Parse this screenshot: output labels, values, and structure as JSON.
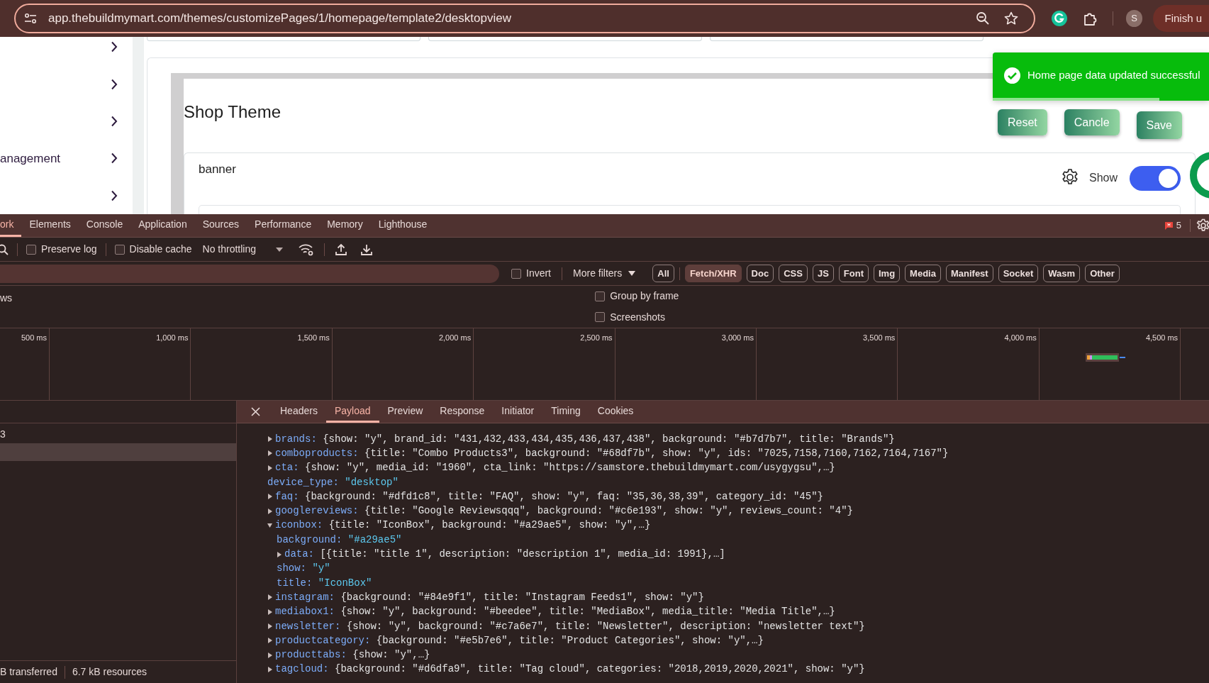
{
  "browser": {
    "url": "app.thebuildmymart.com/themes/customizePages/1/homepage/template2/desktopview",
    "profile_initial": "S",
    "action_button": "Finish u"
  },
  "page": {
    "sidebar": {
      "items": [
        {
          "kind": "chevron"
        },
        {
          "kind": "chevron"
        },
        {
          "kind": "chevron"
        },
        {
          "kind": "labeled",
          "label": "anagement"
        },
        {
          "kind": "chevron"
        }
      ]
    },
    "title": "Shop Theme",
    "buttons": [
      "Reset",
      "Cancle",
      "Save"
    ],
    "toast": {
      "message": "Home page data updated successful",
      "level": 0.77
    },
    "section": {
      "title": "banner",
      "show_label": "Show",
      "on": true
    }
  },
  "devtools": {
    "tabs": [
      {
        "label": "ork",
        "selected": true
      },
      {
        "label": "Elements",
        "selected": false
      },
      {
        "label": "Console",
        "selected": false
      },
      {
        "label": "Application",
        "selected": false
      },
      {
        "label": "Sources",
        "selected": false
      },
      {
        "label": "Performance",
        "selected": false
      },
      {
        "label": "Memory",
        "selected": false
      },
      {
        "label": "Lighthouse",
        "selected": false
      }
    ],
    "issues_count": "5",
    "toolbar": {
      "checkboxes": [
        {
          "label": "Preserve log",
          "checked": false
        },
        {
          "label": "Disable cache",
          "checked": false
        }
      ],
      "throttling": "No throttling"
    },
    "filter": {
      "invert": {
        "label": "Invert",
        "checked": false
      },
      "more_filters": "More filters",
      "types": [
        {
          "label": "All",
          "selected": false
        },
        {
          "label": "Fetch/XHR",
          "selected": true
        },
        {
          "label": "Doc",
          "selected": false
        },
        {
          "label": "CSS",
          "selected": false
        },
        {
          "label": "JS",
          "selected": false
        },
        {
          "label": "Font",
          "selected": false
        },
        {
          "label": "Img",
          "selected": false
        },
        {
          "label": "Media",
          "selected": false
        },
        {
          "label": "Manifest",
          "selected": false
        },
        {
          "label": "Socket",
          "selected": false
        },
        {
          "label": "Wasm",
          "selected": false
        },
        {
          "label": "Other",
          "selected": false
        }
      ]
    },
    "options": {
      "partial_label": "ws",
      "checkboxes": [
        {
          "label": "Group by frame",
          "checked": false
        },
        {
          "label": "Screenshots",
          "checked": false
        }
      ]
    },
    "timeline": {
      "ticks": [
        "500 ms",
        "1,000 ms",
        "1,500 ms",
        "2,000 ms",
        "2,500 ms",
        "3,000 ms",
        "3,500 ms",
        "4,000 ms",
        "4,500 ms"
      ]
    },
    "requests": {
      "rows": [
        {
          "name": "3",
          "selected": false
        },
        {
          "selected": true
        }
      ]
    },
    "status_bar": [
      "B transferred",
      "6.7 kB resources"
    ],
    "detail_tabs": [
      {
        "label": "Headers",
        "selected": false
      },
      {
        "label": "Payload",
        "selected": true
      },
      {
        "label": "Preview",
        "selected": false
      },
      {
        "label": "Response",
        "selected": false
      },
      {
        "label": "Initiator",
        "selected": false
      },
      {
        "label": "Timing",
        "selected": false
      },
      {
        "label": "Cookies",
        "selected": false
      }
    ],
    "payload": [
      {
        "key": "brands:",
        "value": "{show: \"y\", brand_id: \"431,432,433,434,435,436,437,438\", background: \"#b7d7b7\", title: \"Brands\"}",
        "expanded": false
      },
      {
        "key": "comboproducts:",
        "value": "{title: \"Combo Products3\", background: \"#68df7b\", show: \"y\", ids: \"7025,7158,7160,7162,7164,7167\"}",
        "expanded": false
      },
      {
        "key": "cta:",
        "value": "{show: \"y\", media_id: \"1960\", cta_link: \"https://samstore.thebuildmymart.com/usygygsu\",…}",
        "expanded": false
      },
      {
        "key": "device_type:",
        "value": "\"desktop\""
      },
      {
        "key": "faq:",
        "value": "{background: \"#dfd1c8\", title: \"FAQ\", show: \"y\", faq: \"35,36,38,39\", category_id: \"45\"}",
        "expanded": false
      },
      {
        "key": "googlereviews:",
        "value": "{title: \"Google Reviewsqqq\", background: \"#c6e193\", show: \"y\", reviews_count: \"4\"}",
        "expanded": false
      },
      {
        "key": "iconbox:",
        "value": "{title: \"IconBox\", background: \"#a29ae5\", show: \"y\",…}",
        "expanded": true,
        "children": [
          {
            "key": "background:",
            "value": "\"#a29ae5\""
          },
          {
            "key": "data:",
            "value": "[{title: \"title 1\", description: \"description 1\", media_id: 1991},…]",
            "expanded": false
          },
          {
            "key": "show:",
            "value": "\"y\""
          },
          {
            "key": "title:",
            "value": "\"IconBox\""
          }
        ]
      },
      {
        "key": "instagram:",
        "value": "{background: \"#84e9f1\", title: \"Instagram Feeds1\", show: \"y\"}",
        "expanded": false
      },
      {
        "key": "mediabox1:",
        "value": "{show: \"y\", background: \"#beedee\", title: \"MediaBox\", media_title: \"Media Title\",…}",
        "expanded": false
      },
      {
        "key": "newsletter:",
        "value": "{show: \"y\", background: \"#c7a6e7\", title: \"Newsletter\", description: \"newsletter text\"}",
        "expanded": false
      },
      {
        "key": "productcategory:",
        "value": "{background: \"#e5b7e6\", title: \"Product Categories\", show: \"y\",…}",
        "expanded": false
      },
      {
        "key": "producttabs:",
        "value": "{show: \"y\",…}",
        "expanded": false
      },
      {
        "key": "tagcloud:",
        "value": "{background: \"#d6dfa9\", title: \"Tag cloud\", categories: \"2018,2019,2020,2021\", show: \"y\"}",
        "expanded": false
      }
    ]
  }
}
